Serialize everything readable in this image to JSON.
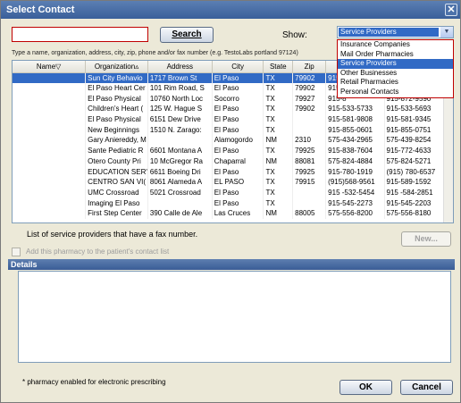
{
  "window": {
    "title": "Select Contact",
    "close_glyph": "✕"
  },
  "search": {
    "value": "",
    "button_label": "Search",
    "hint": "Type a name, organization, address, city, zip, phone and/or fax number (e.g. TestoLabs portland 97124)"
  },
  "show": {
    "label": "Show:",
    "selected": "Service Providers",
    "arrow_icon": "chevron-down-icon",
    "options": [
      "Insurance Companies",
      "Mail Order Pharmacies",
      "Service Providers",
      "Other Businesses",
      "Retail Pharmacies",
      "Personal Contacts"
    ]
  },
  "table": {
    "columns": [
      "Name",
      "Organization",
      "Address",
      "City",
      "State",
      "Zip",
      "Phone",
      "Fax"
    ],
    "sort_icons": {
      "Name": "▽",
      "Organization": "▵"
    },
    "rows": [
      [
        "",
        "Sun City Behavio",
        "1717 Brown St",
        "El Paso",
        "TX",
        "79902",
        "915-",
        ""
      ],
      [
        "",
        "El Paso Heart Cer",
        "101 Rim Road, S",
        "El Paso",
        "TX",
        "79902",
        "915-5",
        "915-542-1910"
      ],
      [
        "",
        "El Paso Physical",
        "10760 North Loc",
        "Socorro",
        "TX",
        "79927",
        "915-8",
        "915-872-9590"
      ],
      [
        "",
        "Children's Heart (",
        "125 W. Hague S",
        "El Paso",
        "TX",
        "79902",
        "915-533-5733",
        "915-533-5693"
      ],
      [
        "",
        "El Paso Physical",
        "6151 Dew Drive",
        "El Paso",
        "TX",
        "",
        "915-581-9808",
        "915-581-9345"
      ],
      [
        "",
        "New Beginnings",
        "1510 N. Zarago:",
        "El Paso",
        "TX",
        "",
        "915-855-0601",
        "915-855-0751"
      ],
      [
        "",
        "Gary Aniereddy, M",
        "",
        "Alamogordo",
        "NM",
        "2310",
        "575-434-2965",
        "575-439-8254"
      ],
      [
        "",
        "Sante Pediatric R",
        "6601 Montana A",
        "El Paso",
        "TX",
        "79925",
        "915-838-7604",
        "915-772-4633"
      ],
      [
        "",
        "Otero County Pri",
        "10 McGregor Ra",
        "Chaparral",
        "NM",
        "88081",
        "575-824-4884",
        "575-824-5271"
      ],
      [
        "",
        "EDUCATION SER'",
        "6611 Boeing Dri",
        "El Paso",
        "TX",
        "79925",
        "915-780-1919",
        "(915) 780-6537"
      ],
      [
        "",
        "CENTRO SAN VI(",
        "8061 Alameda A",
        "EL PASO",
        "TX",
        "79915",
        "(915)568-9561",
        "915-589-1592"
      ],
      [
        "",
        "UMC Crossroad",
        "5021 Crossroad",
        "El Paso",
        "TX",
        "",
        "915 -532-5454",
        "915 -584-2851"
      ],
      [
        "",
        "Imaging El Paso",
        "",
        "El Paso",
        "TX",
        "",
        "915-545-2273",
        "915-545-2203"
      ],
      [
        "",
        "First Step Center",
        "390 Calle de Ale",
        "Las Cruces",
        "NM",
        "88005",
        "575-556-8200",
        "575-556-8180"
      ]
    ]
  },
  "list_message": "List of service providers that have a fax number.",
  "new_button": "New...",
  "add_pharmacy_label": "Add this pharmacy to the patient's contact list",
  "details": {
    "header": "Details"
  },
  "footnote": "* pharmacy enabled for electronic prescribing",
  "buttons": {
    "ok": "OK",
    "cancel": "Cancel"
  }
}
